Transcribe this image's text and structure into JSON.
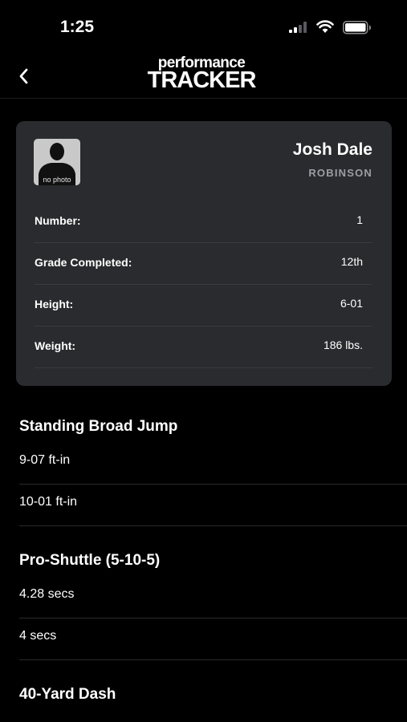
{
  "status_bar": {
    "time": "1:25"
  },
  "nav": {
    "logo_top": "performance",
    "logo_bottom": "TRACKER",
    "back_icon": "chevron-left-icon"
  },
  "profile": {
    "name": "Josh Dale",
    "school": "ROBINSON",
    "photo_caption": "no photo",
    "rows": [
      {
        "label": "Number:",
        "value": "1"
      },
      {
        "label": "Grade Completed:",
        "value": "12th"
      },
      {
        "label": "Height:",
        "value": "6-01"
      },
      {
        "label": "Weight:",
        "value": "186 lbs."
      }
    ]
  },
  "events": [
    {
      "title": "Standing Broad Jump",
      "results": [
        "9-07 ft-in",
        "10-01 ft-in"
      ]
    },
    {
      "title": "Pro-Shuttle (5-10-5)",
      "results": [
        "4.28 secs",
        "4 secs"
      ]
    },
    {
      "title": "40-Yard Dash",
      "results": []
    }
  ],
  "colors": {
    "background": "#000000",
    "card": "#2a2b2e",
    "secondary_text": "#9c9ea3"
  }
}
